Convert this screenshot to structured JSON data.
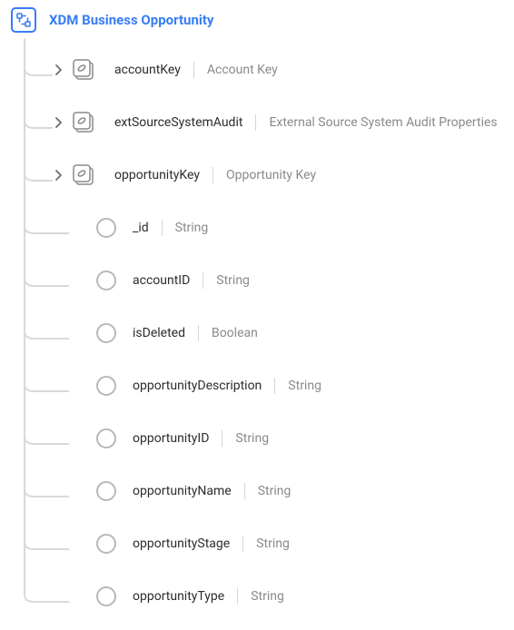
{
  "root": {
    "title": "XDM Business Opportunity"
  },
  "fields": [
    {
      "name": "accountKey",
      "type": "Account Key",
      "kind": "object"
    },
    {
      "name": "extSourceSystemAudit",
      "type": "External Source System Audit Properties",
      "kind": "object"
    },
    {
      "name": "opportunityKey",
      "type": "Opportunity Key",
      "kind": "object"
    },
    {
      "name": "_id",
      "type": "String",
      "kind": "scalar"
    },
    {
      "name": "accountID",
      "type": "String",
      "kind": "scalar"
    },
    {
      "name": "isDeleted",
      "type": "Boolean",
      "kind": "scalar"
    },
    {
      "name": "opportunityDescription",
      "type": "String",
      "kind": "scalar"
    },
    {
      "name": "opportunityID",
      "type": "String",
      "kind": "scalar"
    },
    {
      "name": "opportunityName",
      "type": "String",
      "kind": "scalar"
    },
    {
      "name": "opportunityStage",
      "type": "String",
      "kind": "scalar"
    },
    {
      "name": "opportunityType",
      "type": "String",
      "kind": "scalar"
    }
  ]
}
